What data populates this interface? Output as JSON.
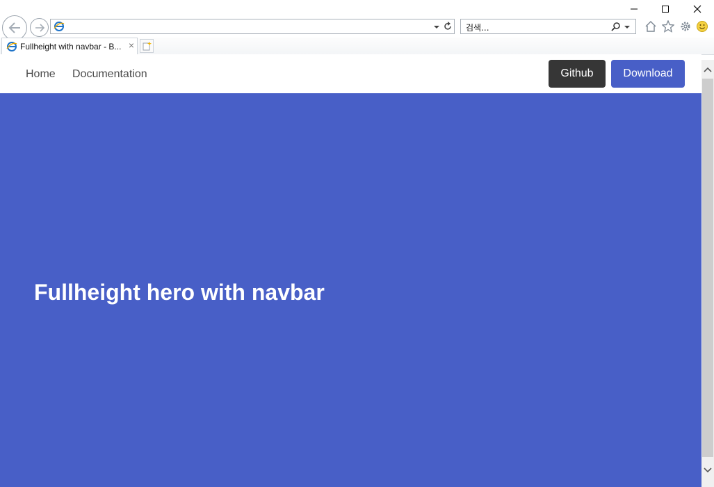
{
  "window": {
    "minimize": "minimize",
    "maximize": "maximize",
    "close": "close"
  },
  "address_bar": {
    "url": "",
    "search_placeholder": "검색..."
  },
  "tab": {
    "title": "Fullheight with navbar - B...",
    "close_glyph": "×"
  },
  "page": {
    "navbar": {
      "links": [
        "Home",
        "Documentation"
      ],
      "github_label": "Github",
      "download_label": "Download"
    },
    "hero": {
      "title": "Fullheight hero with navbar"
    }
  },
  "colors": {
    "hero_bg": "#485fc7",
    "download_bg": "#485fc7",
    "github_bg": "#363636",
    "nav_text": "#4a4a4a"
  },
  "icons": [
    "back-icon",
    "forward-icon",
    "ie-page-icon",
    "dropdown-icon",
    "refresh-icon",
    "search-icon",
    "home-icon",
    "favorites-star-icon",
    "gear-icon",
    "smiley-icon",
    "new-tab-icon",
    "scroll-up-icon",
    "scroll-down-icon"
  ]
}
